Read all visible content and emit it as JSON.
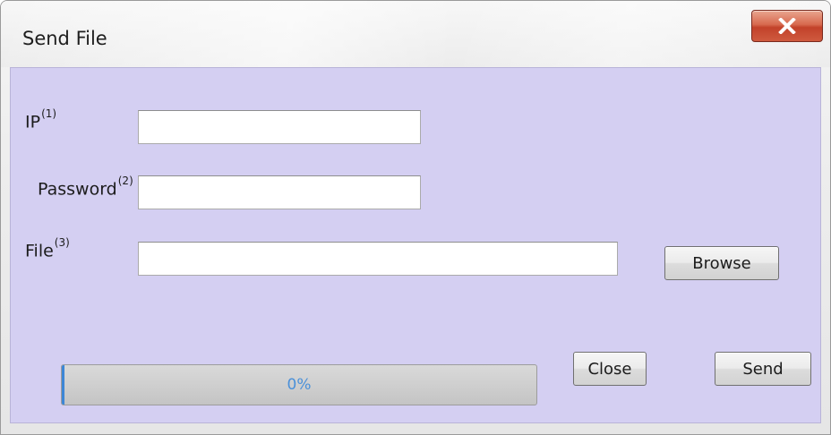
{
  "window": {
    "title": "Send File"
  },
  "icons": {
    "close": "close-x-icon"
  },
  "colors": {
    "client_background": "#d4cff2",
    "close_button": "#c2422a",
    "progress_text": "#4a90d9"
  },
  "form": {
    "ip": {
      "label": "IP",
      "footnote": "(1)",
      "value": "",
      "placeholder": ""
    },
    "password": {
      "label": "Password",
      "footnote": "(2)",
      "value": "",
      "placeholder": ""
    },
    "file": {
      "label": "File",
      "footnote": "(3)",
      "value": "",
      "placeholder": ""
    }
  },
  "buttons": {
    "browse": "Browse",
    "close": "Close",
    "send": "Send"
  },
  "progress": {
    "value": 0,
    "label": "0%"
  }
}
